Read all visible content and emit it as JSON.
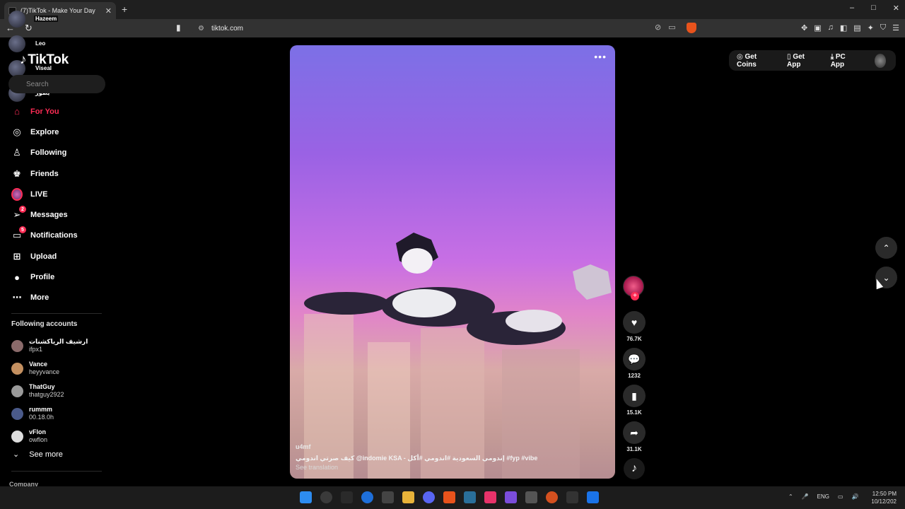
{
  "browser": {
    "tab_title": "(7)TikTok - Make Your Day",
    "url": "tiktok.com",
    "window_buttons": [
      "–",
      "□",
      "✕"
    ]
  },
  "sidebar": {
    "logo": "TikTok",
    "search_placeholder": "Search",
    "nav": [
      {
        "label": "For You",
        "icon": "home-icon",
        "active": true
      },
      {
        "label": "Explore",
        "icon": "compass-icon"
      },
      {
        "label": "Following",
        "icon": "person-follow-icon"
      },
      {
        "label": "Friends",
        "icon": "friends-icon"
      },
      {
        "label": "LIVE",
        "icon": "live-icon"
      },
      {
        "label": "Messages",
        "icon": "paper-plane-icon",
        "badge": "2"
      },
      {
        "label": "Notifications",
        "icon": "inbox-icon",
        "badge": "5"
      },
      {
        "label": "Upload",
        "icon": "plus-box-icon"
      },
      {
        "label": "Profile",
        "icon": "avatar-icon"
      },
      {
        "label": "More",
        "icon": "ellipsis-icon"
      }
    ],
    "following_header": "Following accounts",
    "accounts": [
      {
        "name": "ارشيف الرياكشنات",
        "username": "ifpx1",
        "color": "#8a6a6a"
      },
      {
        "name": "Vance",
        "username": "heyyvance",
        "color": "#c49060"
      },
      {
        "name": "ThatGuy",
        "username": "thatguy2922",
        "color": "#9a9a9a"
      },
      {
        "name": "rummm",
        "username": "00.18.0h",
        "color": "#4a5a8a"
      },
      {
        "name": "vFlon",
        "username": "owflon",
        "color": "#dddddd"
      }
    ],
    "see_more": "See more",
    "company": "Company"
  },
  "floating_users": [
    "Hazeem",
    "Leo",
    "Viseal",
    "يطور"
  ],
  "video": {
    "author": "u4mf",
    "caption": "كيف صرتي اندومي @indomie KSA - إندومي السعودية #اندومي #أكل #fyp #vibe",
    "see_translation": "See translation",
    "likes": "76.7K",
    "comments": "1232",
    "saves": "15.1K",
    "shares": "31.1K"
  },
  "top_bar": {
    "get_coins": "Get Coins",
    "get_app": "Get App",
    "pc_app": "PC App"
  },
  "taskbar": {
    "lang": "ENG",
    "time": "12:50 PM",
    "date": "10/12/202"
  }
}
